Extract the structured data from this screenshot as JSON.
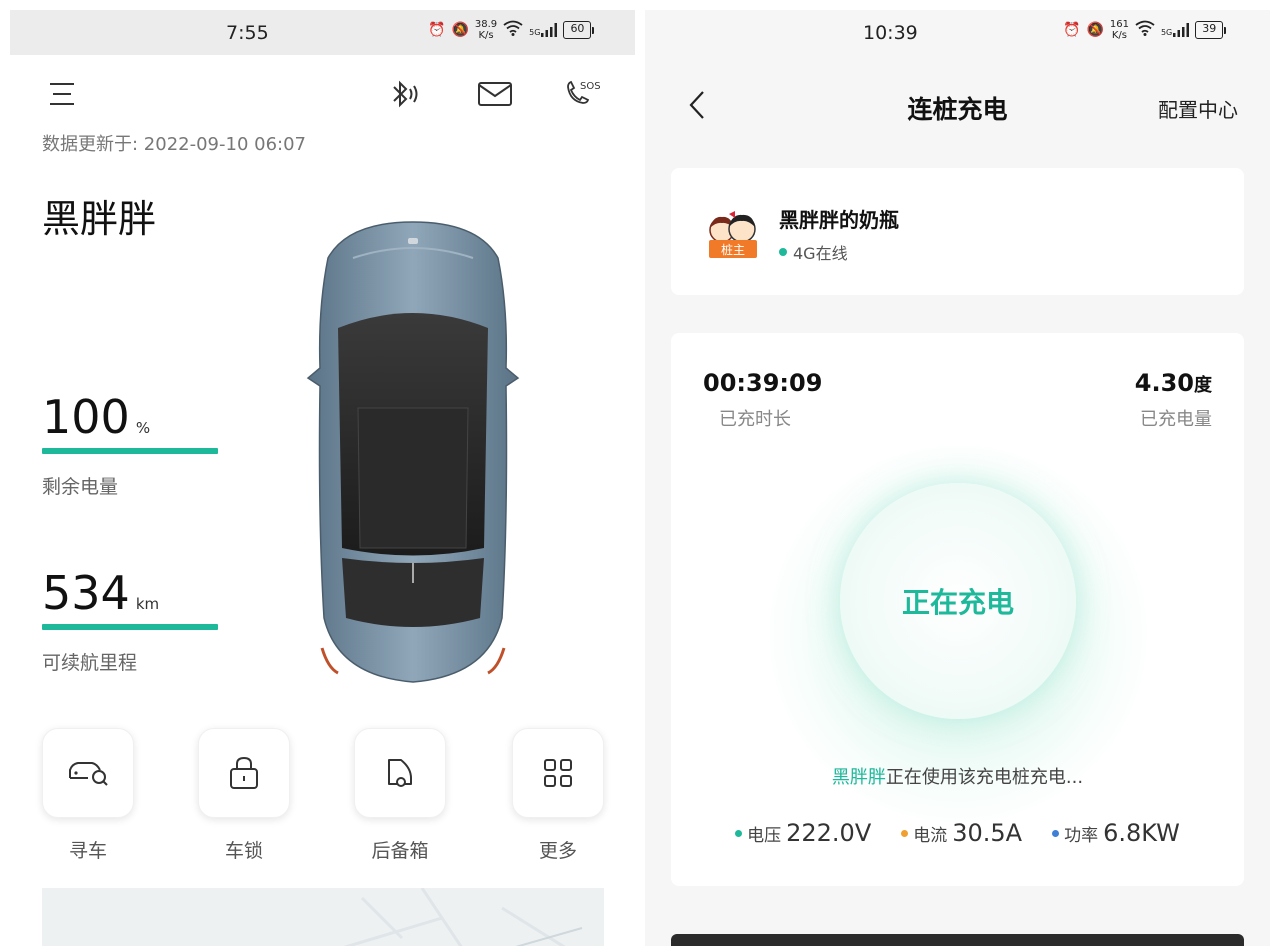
{
  "left": {
    "status": {
      "time": "7:55",
      "speed_top": "38.9",
      "speed_bottom": "K/s",
      "net": "5G",
      "battery": "60"
    },
    "update": "数据更新于: 2022-09-10 06:07",
    "car_name": "黑胖胖",
    "battery": {
      "value": "100",
      "unit": "%",
      "label": "剩余电量",
      "level": 1.0
    },
    "range": {
      "value": "534",
      "unit": "km",
      "label": "可续航里程",
      "level": 1.0
    },
    "actions": [
      {
        "label": "寻车",
        "icon": "car-search-icon"
      },
      {
        "label": "车锁",
        "icon": "lock-icon"
      },
      {
        "label": "后备箱",
        "icon": "trunk-icon"
      },
      {
        "label": "更多",
        "icon": "grid-icon"
      }
    ],
    "sos_label": "SOS"
  },
  "right": {
    "status": {
      "time": "10:39",
      "speed_top": "161",
      "speed_bottom": "K/s",
      "net": "5G",
      "battery": "39"
    },
    "nav": {
      "title": "连桩充电",
      "right": "配置中心"
    },
    "owner": {
      "badge": "桩主",
      "name": "黑胖胖的奶瓶",
      "status": "4G在线"
    },
    "charge": {
      "duration": "00:39:09",
      "duration_label": "已充时长",
      "energy": "4.30",
      "energy_unit": "度",
      "energy_label": "已充电量",
      "state": "正在充电",
      "user": "黑胖胖",
      "using_text": "正在使用该充电桩充电...",
      "voltage_label": "电压",
      "voltage": "222.0V",
      "current_label": "电流",
      "current": "30.5A",
      "power_label": "功率",
      "power": "6.8KW"
    }
  },
  "colors": {
    "accent": "#1eb89a",
    "current_dot": "#f0a030",
    "power_dot": "#3f7fd6"
  }
}
